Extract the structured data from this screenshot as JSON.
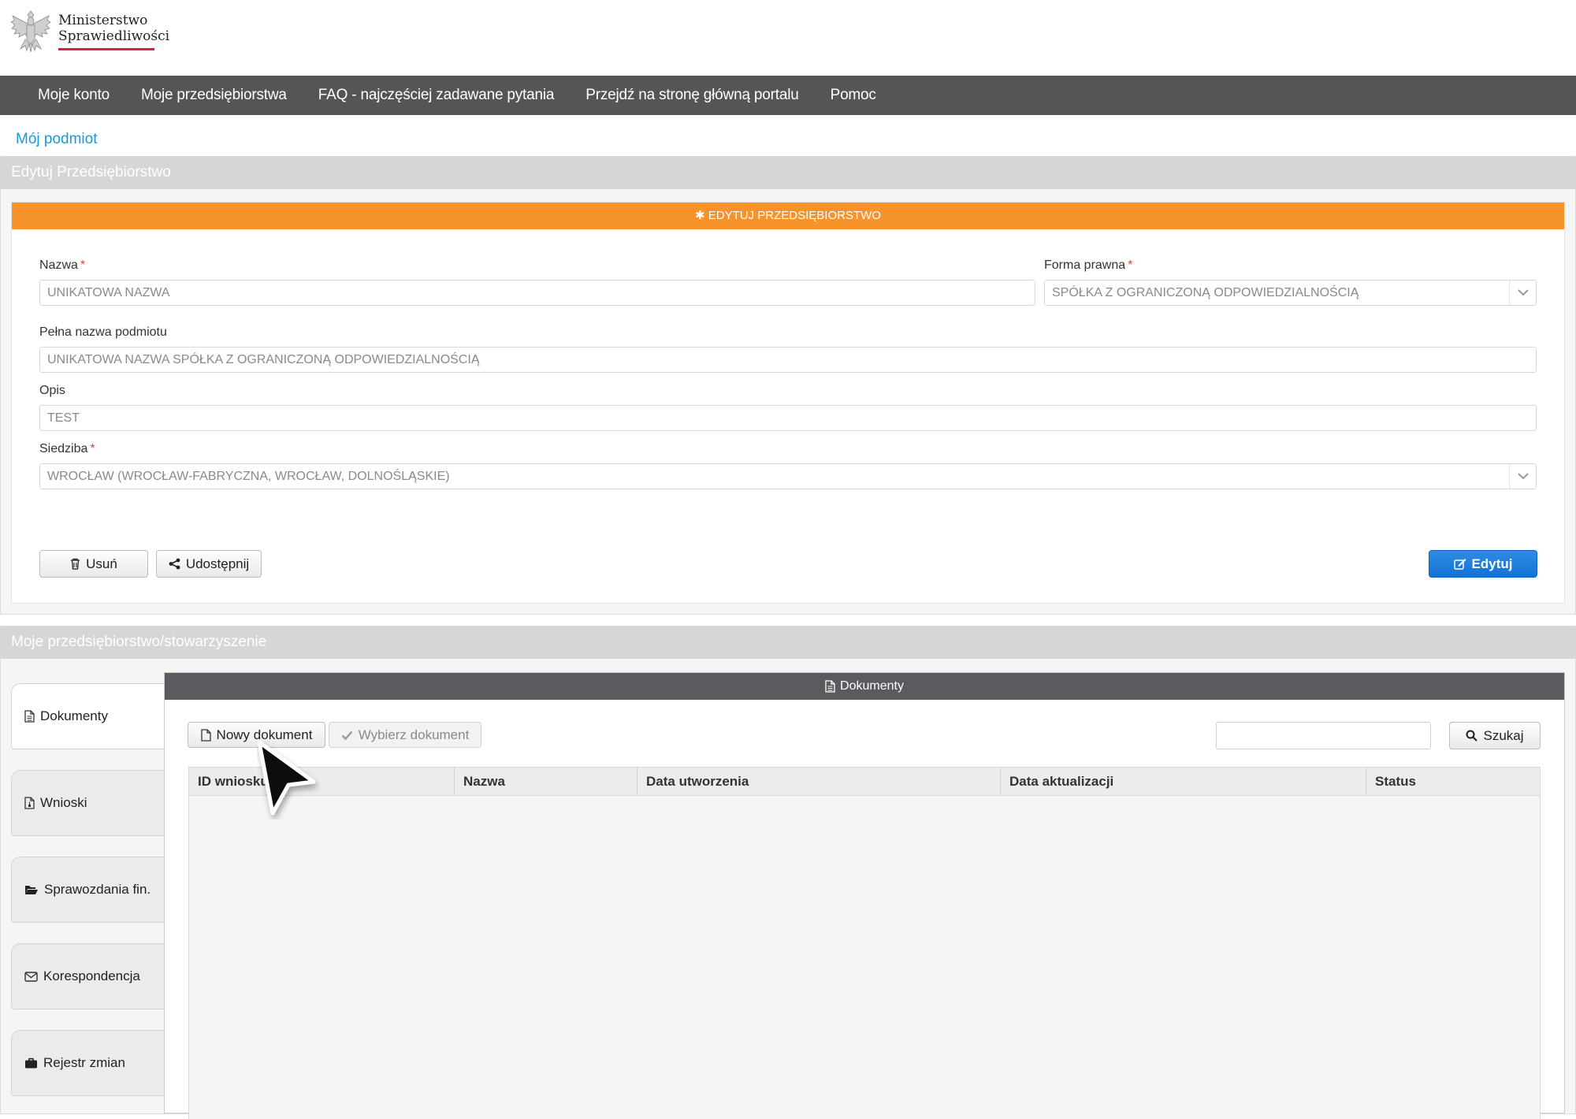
{
  "logo": {
    "line1": "Ministerstwo",
    "line2": "Sprawiedliwości"
  },
  "nav": [
    "Moje konto",
    "Moje przedsiębiorstwa",
    "FAQ - najczęściej zadawane pytania",
    "Przejdź na stronę główną portalu",
    "Pomoc"
  ],
  "breadcrumb": "Mój podmiot",
  "edit_panel": {
    "title": "Edytuj Przedsiębiorstwo",
    "card_title": "EDYTUJ PRZEDSIĘBIORSTWO",
    "fields": {
      "nazwa": {
        "label": "Nazwa",
        "value": "UNIKATOWA NAZWA"
      },
      "forma": {
        "label": "Forma prawna",
        "value": "SPÓŁKA Z OGRANICZONĄ ODPOWIEDZIALNOŚCIĄ"
      },
      "pelna": {
        "label": "Pełna nazwa podmiotu",
        "value": "UNIKATOWA NAZWA SPÓŁKA Z OGRANICZONĄ ODPOWIEDZIALNOŚCIĄ"
      },
      "opis": {
        "label": "Opis",
        "value": "TEST"
      },
      "siedziba": {
        "label": "Siedziba",
        "value": "WROCŁAW (WROCŁAW-FABRYCZNA, WROCŁAW, DOLNOŚLĄSKIE)"
      }
    },
    "required_mark": "*",
    "buttons": {
      "delete": "Usuń",
      "share": "Udostępnij",
      "edit": "Edytuj"
    }
  },
  "company_panel": {
    "title": "Moje przedsiębiorstwo/stowarzyszenie",
    "tabs": [
      "Dokumenty",
      "Wnioski",
      "Sprawozdania fin.",
      "Korespondencja",
      "Rejestr zmian"
    ],
    "active_tab": "Dokumenty",
    "documents": {
      "title": "Dokumenty",
      "new_button": "Nowy dokument",
      "choose_button": "Wybierz dokument",
      "search_value": "",
      "search_button": "Szukaj",
      "columns": [
        "ID wniosku",
        "Nazwa",
        "Data utworzenia",
        "Data aktualizacji",
        "Status"
      ],
      "rows": []
    }
  },
  "colors": {
    "accent_orange": "#f7932b",
    "primary_blue": "#1a7de0",
    "nav_bg": "#555555",
    "link": "#1a9ad6"
  }
}
